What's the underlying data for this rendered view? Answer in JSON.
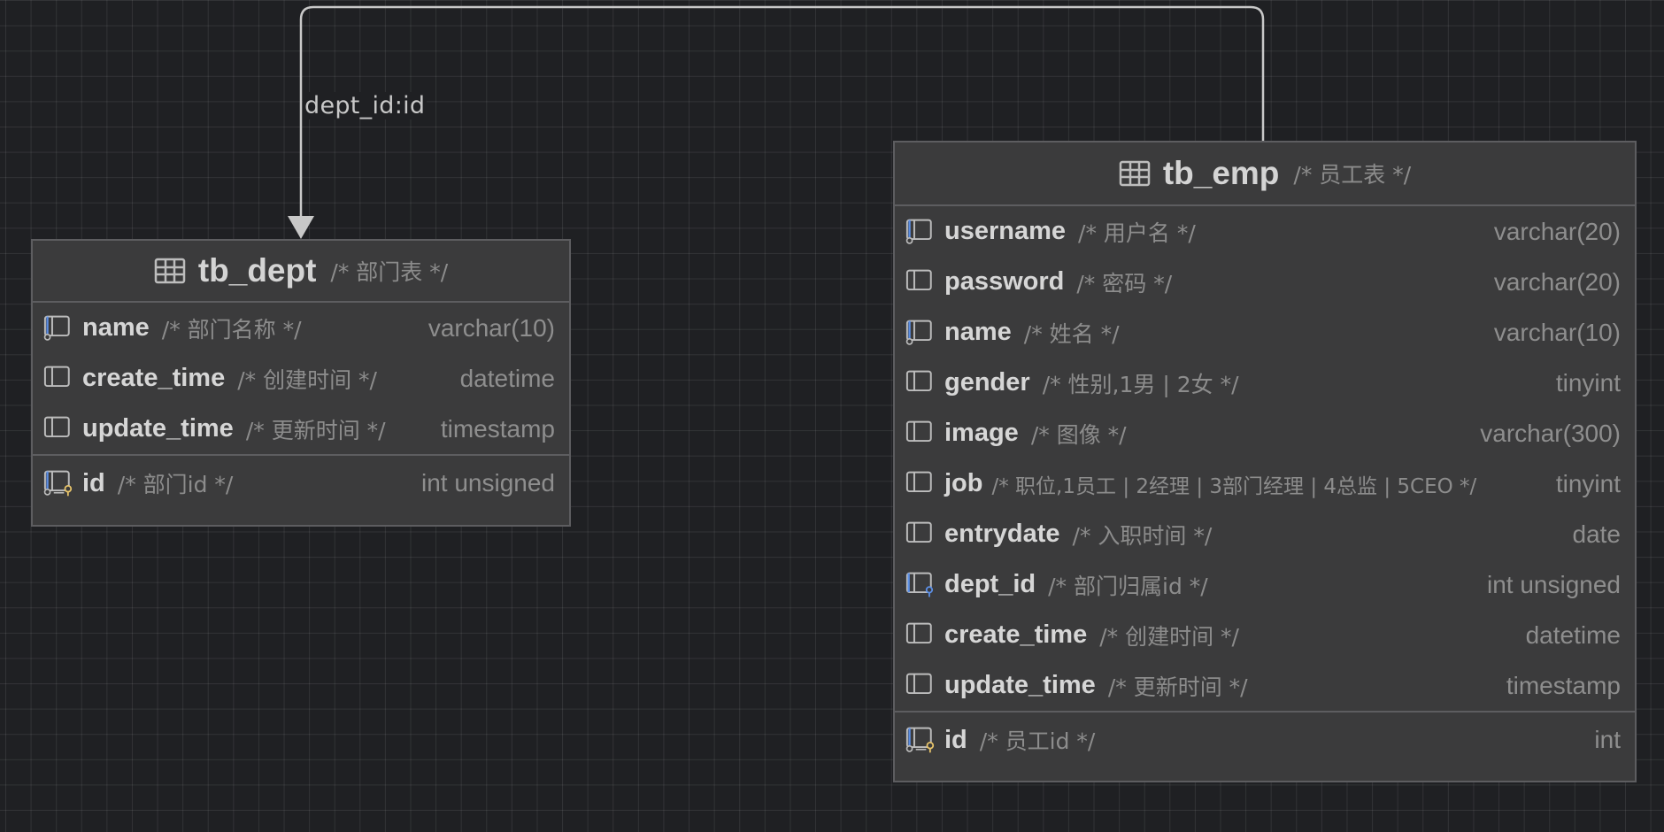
{
  "relation": {
    "label": "dept_id:id"
  },
  "tables": {
    "dept": {
      "name": "tb_dept",
      "comment": "/* 部门表 */",
      "columns": [
        {
          "name": "name",
          "comment": "/* 部门名称 */",
          "type": "varchar(10)",
          "icon": "column-index-icon"
        },
        {
          "name": "create_time",
          "comment": "/* 创建时间 */",
          "type": "datetime",
          "icon": "column-icon"
        },
        {
          "name": "update_time",
          "comment": "/* 更新时间 */",
          "type": "timestamp",
          "icon": "column-icon"
        }
      ],
      "primary_key": {
        "name": "id",
        "comment": "/* 部门id */",
        "type": "int unsigned",
        "icon": "primary-key-icon"
      }
    },
    "emp": {
      "name": "tb_emp",
      "comment": "/* 员工表 */",
      "columns": [
        {
          "name": "username",
          "comment": "/* 用户名 */",
          "type": "varchar(20)",
          "icon": "column-index-icon"
        },
        {
          "name": "password",
          "comment": "/* 密码 */",
          "type": "varchar(20)",
          "icon": "column-icon"
        },
        {
          "name": "name",
          "comment": "/* 姓名 */",
          "type": "varchar(10)",
          "icon": "column-index-icon"
        },
        {
          "name": "gender",
          "comment": "/* 性别,1男 | 2女 */",
          "type": "tinyint",
          "icon": "column-icon"
        },
        {
          "name": "image",
          "comment": "/* 图像 */",
          "type": "varchar(300)",
          "icon": "column-icon"
        },
        {
          "name": "job",
          "comment": "/* 职位,1员工 | 2经理 | 3部门经理 | 4总监 | 5CEO */",
          "type": "tinyint",
          "icon": "column-icon"
        },
        {
          "name": "entrydate",
          "comment": "/* 入职时间 */",
          "type": "date",
          "icon": "column-icon"
        },
        {
          "name": "dept_id",
          "comment": "/* 部门归属id */",
          "type": "int unsigned",
          "icon": "foreign-key-icon"
        },
        {
          "name": "create_time",
          "comment": "/* 创建时间 */",
          "type": "datetime",
          "icon": "column-icon"
        },
        {
          "name": "update_time",
          "comment": "/* 更新时间 */",
          "type": "timestamp",
          "icon": "column-icon"
        }
      ],
      "primary_key": {
        "name": "id",
        "comment": "/* 员工id */",
        "type": "int",
        "icon": "primary-key-icon"
      }
    }
  },
  "colors": {
    "background": "#1f2023",
    "table_bg": "#3b3b3c",
    "border": "#5d5d60",
    "blue": "#5c8fe6",
    "gold": "#e8c46a"
  }
}
